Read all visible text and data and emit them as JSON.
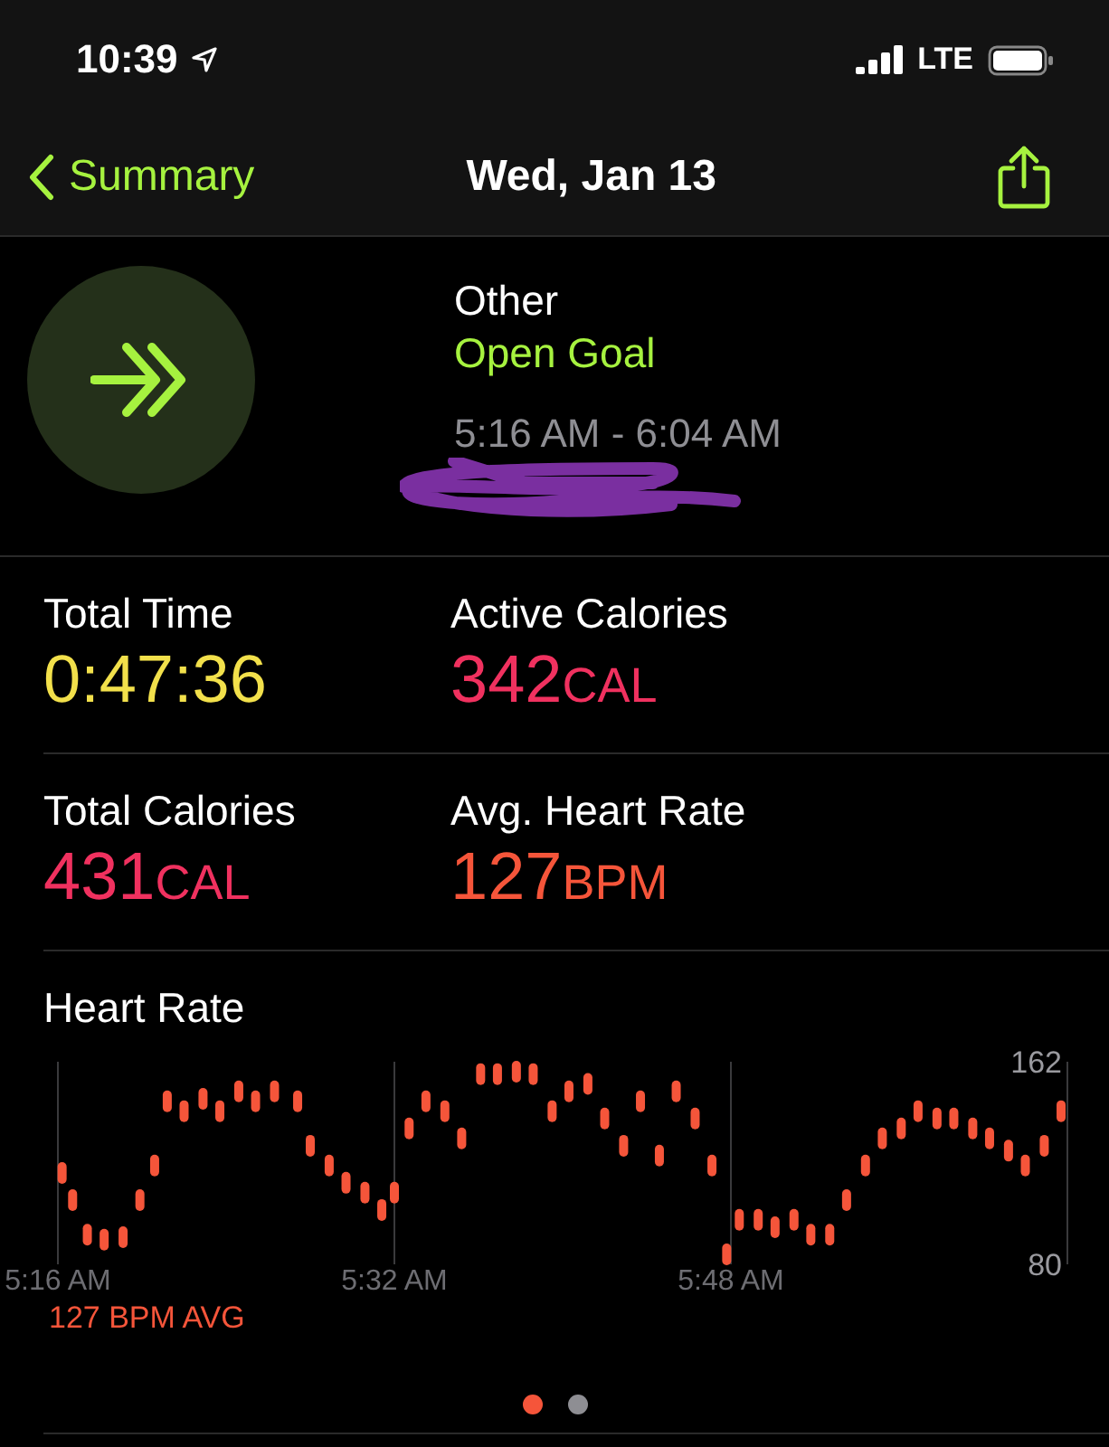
{
  "status_bar": {
    "time": "10:39",
    "network": "LTE"
  },
  "nav": {
    "back": "Summary",
    "title": "Wed, Jan 13"
  },
  "workout": {
    "type": "Other",
    "goal": "Open Goal",
    "time_range": "5:16 AM - 6:04 AM"
  },
  "metrics": [
    {
      "label": "Total Time",
      "value": "0:47:36",
      "color": "#f2e04b"
    },
    {
      "label": "Active Calories",
      "value": "342",
      "unit": "CAL",
      "color": "#f0315f"
    },
    {
      "label": "Total Calories",
      "value": "431",
      "unit": "CAL",
      "color": "#f0315f"
    },
    {
      "label": "Avg. Heart Rate",
      "value": "127",
      "unit": "BPM",
      "color": "#f5553a"
    }
  ],
  "heart_rate": {
    "title": "Heart Rate",
    "average": "127 BPM AVG",
    "chart_data": {
      "type": "scatter",
      "xlim": [
        316,
        364
      ],
      "ylim": [
        80,
        162
      ],
      "yticks": [
        80,
        162
      ],
      "xticks": [
        {
          "value": 316,
          "label": "5:16 AM"
        },
        {
          "value": 332,
          "label": "5:32 AM"
        },
        {
          "value": 348,
          "label": "5:48 AM"
        }
      ],
      "series": [
        {
          "color": "#f5553a",
          "x": [
            316.2,
            316.7,
            317.4,
            318.2,
            319.1,
            319.9,
            320.6,
            321.2,
            322.0,
            322.9,
            323.7,
            324.6,
            325.4,
            326.3,
            327.4,
            328.0,
            328.9,
            329.7,
            330.6,
            331.4,
            332.0,
            332.7,
            333.5,
            334.4,
            335.2,
            336.1,
            336.9,
            337.8,
            338.6,
            339.5,
            340.3,
            341.2,
            342.0,
            342.9,
            343.7,
            344.6,
            345.4,
            346.3,
            347.1,
            347.8,
            348.4,
            349.3,
            350.1,
            351.0,
            351.8,
            352.7,
            353.5,
            354.4,
            355.2,
            356.1,
            356.9,
            357.8,
            358.6,
            359.5,
            360.3,
            361.2,
            362.0,
            362.9,
            363.7
          ],
          "values": [
            117,
            106,
            92,
            90,
            91,
            106,
            120,
            146,
            142,
            147,
            142,
            150,
            146,
            150,
            146,
            128,
            120,
            113,
            109,
            102,
            109,
            135,
            146,
            142,
            131,
            157,
            157,
            158,
            157,
            142,
            150,
            153,
            139,
            128,
            146,
            124,
            150,
            139,
            120,
            84,
            98,
            98,
            95,
            98,
            92,
            92,
            106,
            120,
            131,
            135,
            142,
            139,
            139,
            135,
            131,
            126,
            120,
            128,
            142
          ]
        }
      ]
    }
  },
  "pager": [
    {
      "selected": true
    },
    {
      "selected": false
    }
  ]
}
